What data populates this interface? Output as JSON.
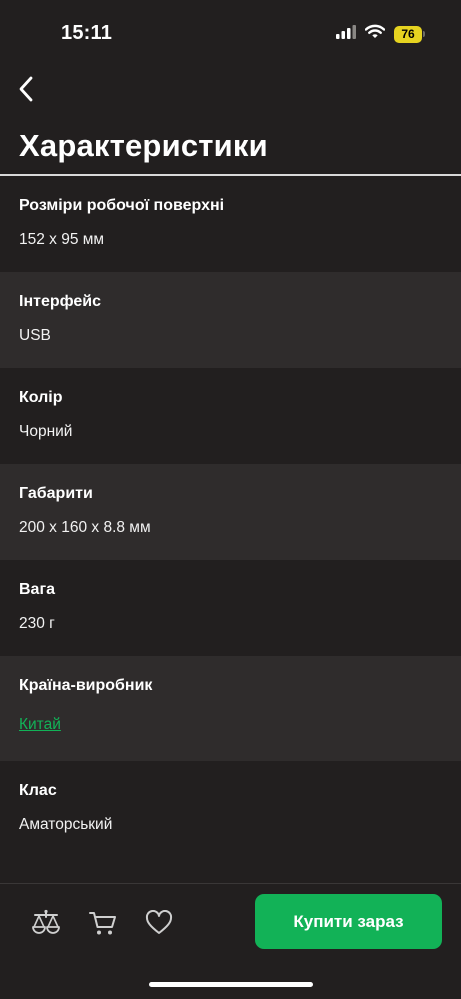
{
  "status_bar": {
    "time": "15:11",
    "battery": "76",
    "icons": [
      "signal-icon",
      "wifi-icon",
      "battery-icon"
    ],
    "battery_color": "#e6d320"
  },
  "header": {
    "back_icon": "chevron-left-icon",
    "title": "Характеристики"
  },
  "specs": [
    {
      "name": "Розміри робочої поверхні",
      "value": "152 x 95 мм",
      "is_link": false
    },
    {
      "name": "Інтерфейс",
      "value": "USB",
      "is_link": false
    },
    {
      "name": "Колір",
      "value": "Чорний",
      "is_link": false
    },
    {
      "name": "Габарити",
      "value": "200 x 160 x 8.8 мм",
      "is_link": false
    },
    {
      "name": "Вага",
      "value": "230 г",
      "is_link": false
    },
    {
      "name": "Країна-виробник",
      "value": "Китай",
      "is_link": true
    },
    {
      "name": "Клас",
      "value": "Аматорський",
      "is_link": false
    }
  ],
  "bottom_bar": {
    "icons": [
      "compare-scales-icon",
      "cart-icon",
      "heart-icon"
    ],
    "buy_label": "Купити зараз"
  },
  "colors": {
    "background": "#221f1f",
    "alt_row": "#2f2c2c",
    "accent": "#12b257"
  }
}
